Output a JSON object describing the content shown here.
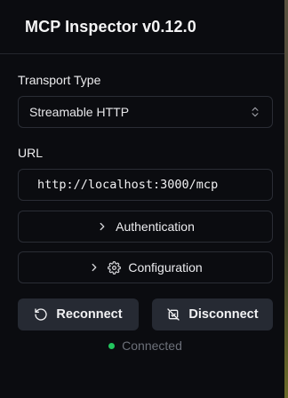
{
  "app": {
    "title": "MCP Inspector v0.12.0"
  },
  "transport": {
    "label": "Transport Type",
    "selected": "Streamable HTTP"
  },
  "url": {
    "label": "URL",
    "value": "http://localhost:3000/mcp"
  },
  "sections": {
    "authentication": "Authentication",
    "configuration": "Configuration"
  },
  "actions": {
    "reconnect": "Reconnect",
    "disconnect": "Disconnect"
  },
  "status": {
    "text": "Connected",
    "color": "#22c55e"
  },
  "icons": {
    "transport_select": "chevron-up-down-icon",
    "authentication": "chevron-right-icon",
    "configuration": [
      "chevron-right-icon",
      "gear-icon"
    ],
    "reconnect": "refresh-icon",
    "disconnect": "unplug-icon"
  }
}
